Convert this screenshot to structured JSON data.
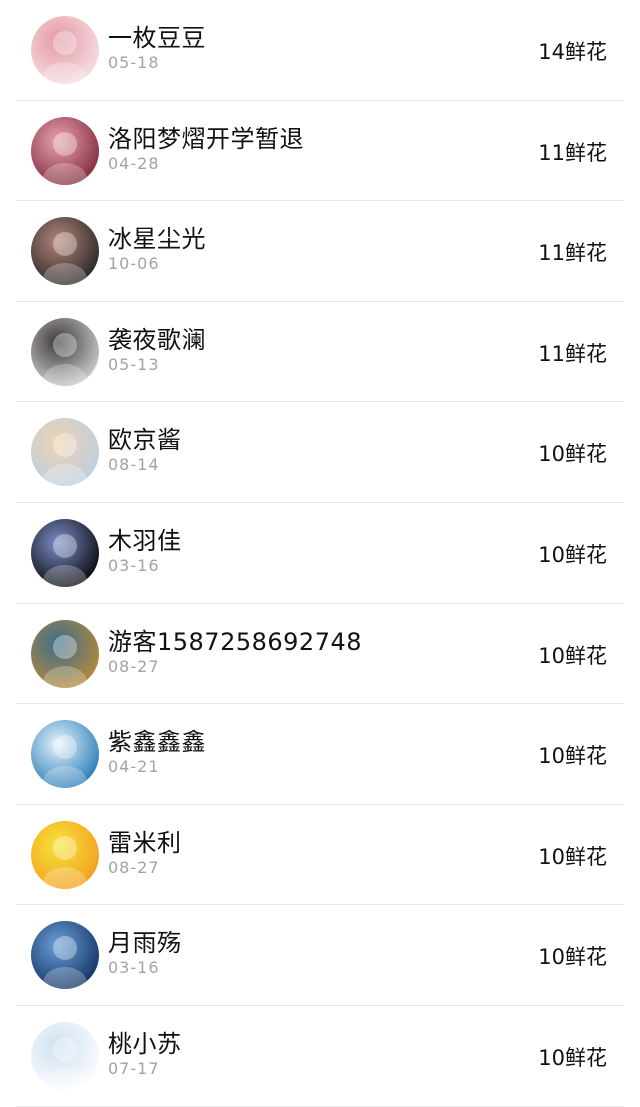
{
  "rows": [
    {
      "name": "一枚豆豆",
      "date": "05-18",
      "flowers": "14鲜花",
      "avatar_colors": [
        "#f7e3e6",
        "#e59aa6"
      ]
    },
    {
      "name": "洛阳梦熠开学暂退",
      "date": "04-28",
      "flowers": "11鲜花",
      "avatar_colors": [
        "#7b2335",
        "#e7a3b1"
      ]
    },
    {
      "name": "冰星尘光",
      "date": "10-06",
      "flowers": "11鲜花",
      "avatar_colors": [
        "#1f1f1f",
        "#b3867a"
      ]
    },
    {
      "name": "袭夜歌澜",
      "date": "05-13",
      "flowers": "11鲜花",
      "avatar_colors": [
        "#d8d6d6",
        "#3e3a3b"
      ]
    },
    {
      "name": "欧京酱",
      "date": "08-14",
      "flowers": "10鲜花",
      "avatar_colors": [
        "#b8cfe4",
        "#efd2b2"
      ]
    },
    {
      "name": "木羽佳",
      "date": "03-16",
      "flowers": "10鲜花",
      "avatar_colors": [
        "#000000",
        "#7d8fc7"
      ]
    },
    {
      "name": "游客1587258692748",
      "date": "08-27",
      "flowers": "10鲜花",
      "avatar_colors": [
        "#c08b32",
        "#3c6d8f"
      ]
    },
    {
      "name": "紫鑫鑫鑫",
      "date": "04-21",
      "flowers": "10鲜花",
      "avatar_colors": [
        "#1d73b3",
        "#e5f4fb"
      ]
    },
    {
      "name": "雷米利",
      "date": "08-27",
      "flowers": "10鲜花",
      "avatar_colors": [
        "#f29a1e",
        "#f7e33b"
      ]
    },
    {
      "name": "月雨殇",
      "date": "03-16",
      "flowers": "10鲜花",
      "avatar_colors": [
        "#0e2b5c",
        "#6ba0d8"
      ]
    },
    {
      "name": "桃小苏",
      "date": "07-17",
      "flowers": "10鲜花",
      "avatar_colors": [
        "#ffffff",
        "#cfe0f2"
      ]
    }
  ]
}
